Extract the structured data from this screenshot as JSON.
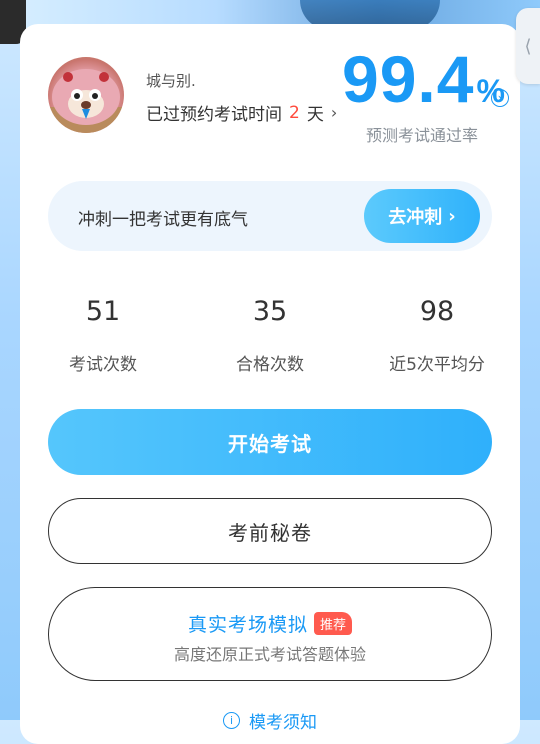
{
  "profile": {
    "user_name": "城与别.",
    "exam_prefix": "已过预约考试时间",
    "exam_days": "2",
    "exam_suffix": "天",
    "arrow": "›"
  },
  "pass_rate": {
    "value": "99.4",
    "unit": "%",
    "label": "预测考试通过率",
    "chevron": "›"
  },
  "sprint": {
    "text": "冲刺一把考试更有底气",
    "button_label": "去冲刺",
    "button_chevron": "›"
  },
  "stats": [
    {
      "value": "51",
      "label": "考试次数"
    },
    {
      "value": "35",
      "label": "合格次数"
    },
    {
      "value": "98",
      "label": "近5次平均分"
    }
  ],
  "actions": {
    "start_label": "开始考试",
    "secret_label": "考前秘卷",
    "simulate_title": "真实考场模拟",
    "simulate_badge": "推荐",
    "simulate_subtitle": "高度还原正式考试答题体验",
    "notice_label": "模考须知",
    "notice_icon": "i"
  },
  "side_tab": {
    "glyph": "⟨"
  },
  "icons": {
    "avatar": "plush-toy-avatar",
    "info": "info-icon"
  },
  "colors": {
    "accent": "#1a99f5",
    "days_highlight": "#ff4a3c",
    "badge": "#ff5a4e"
  }
}
